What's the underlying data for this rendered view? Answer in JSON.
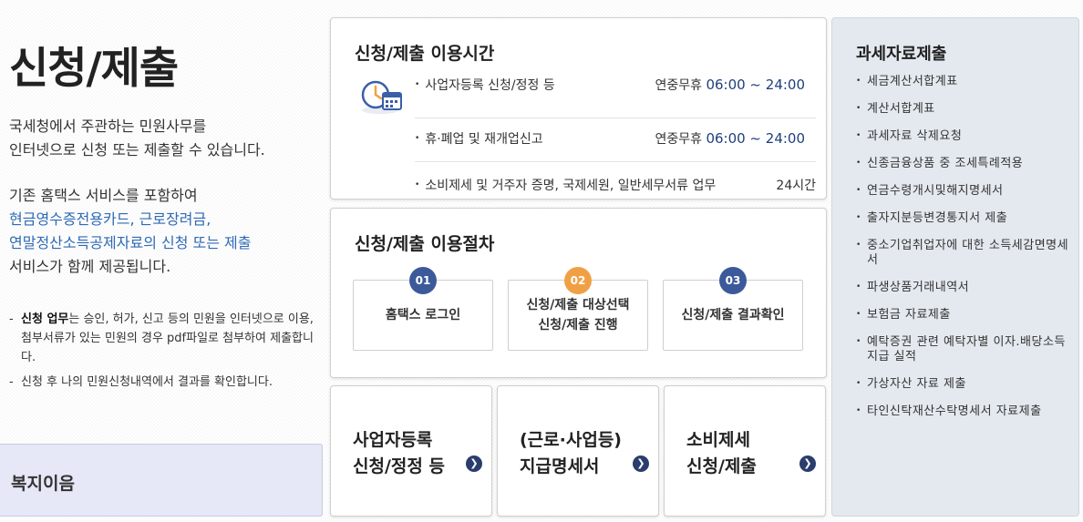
{
  "page_title": "신청/제출",
  "intro": {
    "line1": "국세청에서 주관하는 민원사무를",
    "line2": "인터넷으로 신청 또는 제출할 수 있습니다.",
    "line3": "기존 홈택스 서비스를 포함하여",
    "line4": "현금영수증전용카드, 근로장려금,",
    "line5": "연말정산소득공제자료의 신청 또는 제출",
    "line6": "서비스가 함께 제공됩니다."
  },
  "notes": {
    "note1_bold": "신청 업무",
    "note1_text": "는 승인, 허가, 신고 등의 민원을 인터넷으로 이용, 첨부서류가 있는 민원의 경우 pdf파일로 첨부하여 제출합니다.",
    "note2_text": "신청 후 나의 민원신청내역에서 결과를 확인합니다."
  },
  "welfare_label": "복지이음",
  "hours": {
    "title": "신청/제출 이용시간",
    "icon": "clock-calendar-icon",
    "rows": [
      {
        "name": "사업자등록 신청/정정 등",
        "when": "연중무휴",
        "time": "06:00 ~ 24:00"
      },
      {
        "name": "휴·폐업 및 재개업신고",
        "when": "연중무휴",
        "time": "06:00 ~ 24:00"
      },
      {
        "name": "소비제세 및 거주자 증명, 국제세원, 일반세무서류 업무",
        "when": "",
        "time": "24시간"
      }
    ]
  },
  "process": {
    "title": "신청/제출 이용절차",
    "steps": [
      {
        "num": "01",
        "line1": "홈택스 로그인",
        "line2": "",
        "color": "#3c5a9a"
      },
      {
        "num": "02",
        "line1": "신청/제출 대상선택",
        "line2": "신청/제출 진행",
        "color": "#f0a044"
      },
      {
        "num": "03",
        "line1": "신청/제출 결과확인",
        "line2": "",
        "color": "#3c5a9a"
      }
    ]
  },
  "services": [
    {
      "line1": "사업자등록",
      "line2": "신청/정정 등",
      "icon": "arrow-right-circle-icon"
    },
    {
      "line1": "(근로·사업등)",
      "line2": "지급명세서",
      "icon": "arrow-right-circle-icon"
    },
    {
      "line1": "소비제세",
      "line2": "신청/제출",
      "icon": "arrow-right-circle-icon"
    }
  ],
  "tax": {
    "title": "과세자료제출",
    "items": [
      "세금계산서합계표",
      "계산서합계표",
      "과세자료 삭제요청",
      "신종금융상품 중 조세특례적용",
      "연금수령개시및해지명세서",
      "출자지분등변경통지서 제출",
      "중소기업취업자에 대한 소득세감면명세서",
      "파생상품거래내역서",
      "보험금 자료제출",
      "예탁증권 관련 예탁자별 이자.배당소득 지급 실적",
      "가상자산 자료 제출",
      "타인신탁재산수탁명세서 자료제출"
    ]
  },
  "colors": {
    "accent_blue": "#2e6ab5",
    "navy": "#2a3d6c",
    "orange": "#f0a044",
    "welfare_bg": "#e6e7f7",
    "tax_bg": "#e4e9ef"
  }
}
